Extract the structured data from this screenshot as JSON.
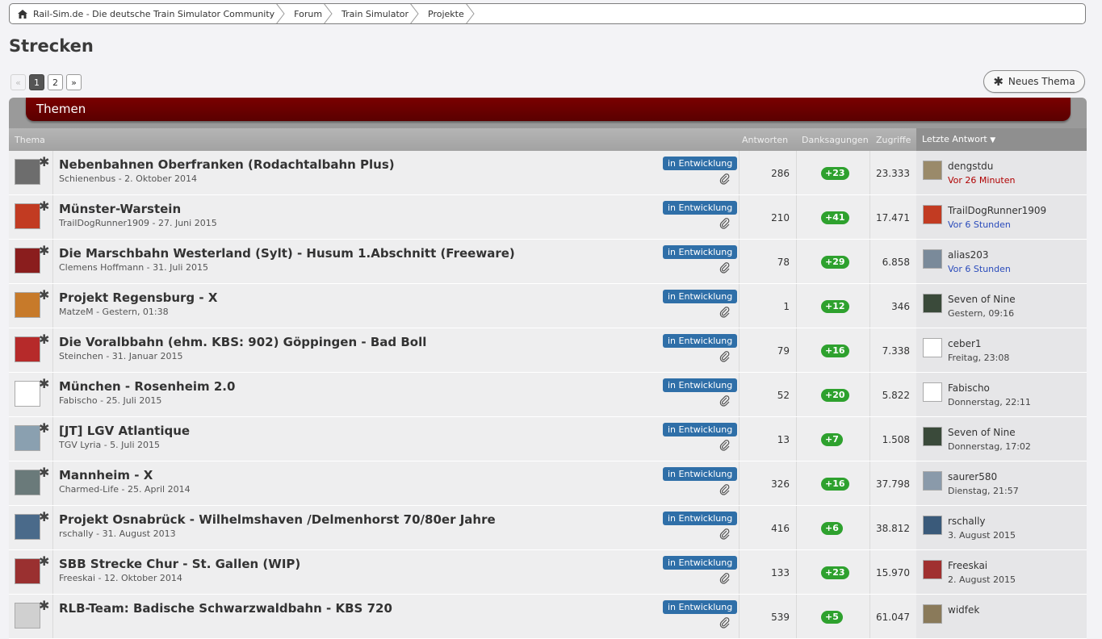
{
  "breadcrumb": [
    "Rail-Sim.de - Die deutsche Train Simulator Community",
    "Forum",
    "Train Simulator",
    "Projekte"
  ],
  "page_title": "Strecken",
  "pagination": {
    "prev": "«",
    "pages": [
      "1",
      "2"
    ],
    "next": "»",
    "current": "1"
  },
  "new_topic_label": "Neues Thema",
  "section_title": "Themen",
  "columns": {
    "thema": "Thema",
    "antworten": "Antworten",
    "danksagungen": "Danksagungen",
    "zugriffe": "Zugriffe",
    "letzte_antwort": "Letzte Antwort"
  },
  "accent": "#5a0000",
  "topics": [
    {
      "title": "Nebenbahnen Oberfranken (Rodachtalbahn Plus)",
      "meta": "Schienenbus - 2. Oktober 2014",
      "badge": "in Entwicklung",
      "replies": "286",
      "thanks": "+23",
      "views": "23.333",
      "last_user": "dengstdu",
      "last_time": "Vor 26 Minuten",
      "time_style": "red"
    },
    {
      "title": "Münster-Warstein",
      "meta": "TrailDogRunner1909 - 27. Juni 2015",
      "badge": "in Entwicklung",
      "replies": "210",
      "thanks": "+41",
      "views": "17.471",
      "last_user": "TrailDogRunner1909",
      "last_time": "Vor 6 Stunden",
      "time_style": "blue"
    },
    {
      "title": "Die Marschbahn Westerland (Sylt) - Husum 1.Abschnitt (Freeware)",
      "meta": "Clemens Hoffmann - 31. Juli 2015",
      "badge": "in Entwicklung",
      "replies": "78",
      "thanks": "+29",
      "views": "6.858",
      "last_user": "alias203",
      "last_time": "Vor 6 Stunden",
      "time_style": "blue"
    },
    {
      "title": "Projekt Regensburg - X",
      "meta": "MatzeM - Gestern, 01:38",
      "badge": "in Entwicklung",
      "replies": "1",
      "thanks": "+12",
      "views": "346",
      "last_user": "Seven of Nine",
      "last_time": "Gestern, 09:16",
      "time_style": "gray"
    },
    {
      "title": "Die Voralbbahn (ehm. KBS: 902) Göppingen - Bad Boll",
      "meta": "Steinchen - 31. Januar 2015",
      "badge": "in Entwicklung",
      "replies": "79",
      "thanks": "+16",
      "views": "7.338",
      "last_user": "ceber1",
      "last_time": "Freitag, 23:08",
      "time_style": "gray"
    },
    {
      "title": "München - Rosenheim 2.0",
      "meta": "Fabischo - 25. Juli 2015",
      "badge": "in Entwicklung",
      "replies": "52",
      "thanks": "+20",
      "views": "5.822",
      "last_user": "Fabischo",
      "last_time": "Donnerstag, 22:11",
      "time_style": "gray"
    },
    {
      "title": "[JT] LGV Atlantique",
      "meta": "TGV Lyria - 5. Juli 2015",
      "badge": "in Entwicklung",
      "replies": "13",
      "thanks": "+7",
      "views": "1.508",
      "last_user": "Seven of Nine",
      "last_time": "Donnerstag, 17:02",
      "time_style": "gray"
    },
    {
      "title": "Mannheim - X",
      "meta": "Charmed-Life - 25. April 2014",
      "badge": "in Entwicklung",
      "replies": "326",
      "thanks": "+16",
      "views": "37.798",
      "last_user": "saurer580",
      "last_time": "Dienstag, 21:57",
      "time_style": "gray"
    },
    {
      "title": "Projekt Osnabrück - Wilhelmshaven /Delmenhorst 70/80er Jahre",
      "meta": "rschally - 31. August 2013",
      "badge": "in Entwicklung",
      "replies": "416",
      "thanks": "+6",
      "views": "38.812",
      "last_user": "rschally",
      "last_time": "3. August 2015",
      "time_style": "gray"
    },
    {
      "title": "SBB Strecke Chur - St. Gallen (WIP)",
      "meta": "Freeskai - 12. Oktober 2014",
      "badge": "in Entwicklung",
      "replies": "133",
      "thanks": "+23",
      "views": "15.970",
      "last_user": "Freeskai",
      "last_time": "2. August 2015",
      "time_style": "gray"
    },
    {
      "title": "RLB-Team: Badische Schwarzwaldbahn - KBS 720",
      "meta": "",
      "badge": "in Entwicklung",
      "replies": "539",
      "thanks": "+5",
      "views": "61.047",
      "last_user": "widfek",
      "last_time": "",
      "time_style": "gray"
    }
  ]
}
